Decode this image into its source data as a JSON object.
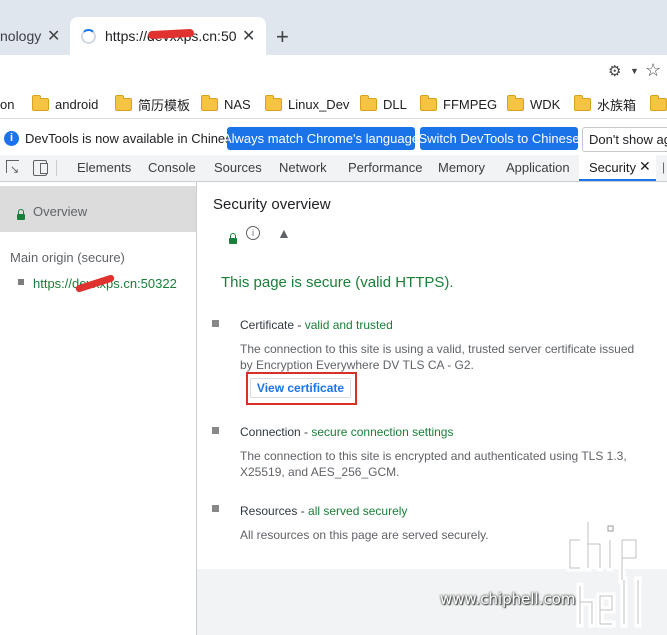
{
  "browser": {
    "tabs": [
      {
        "label": "nology",
        "state": "inactive"
      },
      {
        "label": "https://devxxps.cn:50",
        "state": "active-loading"
      }
    ],
    "new_tab_symbol": "+",
    "close_symbol": "✕"
  },
  "bookmarks": [
    {
      "label": "on",
      "folder": false
    },
    {
      "label": "android",
      "folder": true
    },
    {
      "label": "简历模板",
      "folder": true
    },
    {
      "label": "NAS",
      "folder": true
    },
    {
      "label": "Linux_Dev",
      "folder": true
    },
    {
      "label": "DLL",
      "folder": true
    },
    {
      "label": "FFMPEG",
      "folder": true
    },
    {
      "label": "WDK",
      "folder": true
    },
    {
      "label": "水族箱",
      "folder": true
    }
  ],
  "infobar": {
    "icon": "i",
    "message": "DevTools is now available in Chinese!",
    "buttons": [
      "Always match Chrome's language",
      "Switch DevTools to Chinese"
    ],
    "dismiss": "Don't show aga"
  },
  "devtools": {
    "tabs": [
      "Elements",
      "Console",
      "Sources",
      "Network",
      "Performance",
      "Memory",
      "Application"
    ],
    "active_tab": "Security"
  },
  "sidebar": {
    "overview_label": "Overview",
    "origin_heading": "Main origin (secure)",
    "origin_url": "https://devxxps.cn:50322"
  },
  "security": {
    "title": "Security overview",
    "summary": "This page is secure (valid HTTPS).",
    "certificate": {
      "label": "Certificate - ",
      "status": "valid and trusted",
      "body": "The connection to this site is using a valid, trusted server certificate issued by Encryption Everywhere DV TLS CA - G2.",
      "button": "View certificate"
    },
    "connection": {
      "label": "Connection - ",
      "status": "secure connection settings",
      "body": "The connection to this site is encrypted and authenticated using TLS 1.3, X25519, and AES_256_GCM."
    },
    "resources": {
      "label": "Resources - ",
      "status": "all served securely",
      "body": "All resources on this page are served securely."
    }
  },
  "watermark": {
    "logo": "chiphell",
    "url": "www.chiphell.com"
  },
  "colors": {
    "secure_green": "#188038",
    "link_blue": "#1a73e8",
    "highlight_red": "#d93025"
  }
}
